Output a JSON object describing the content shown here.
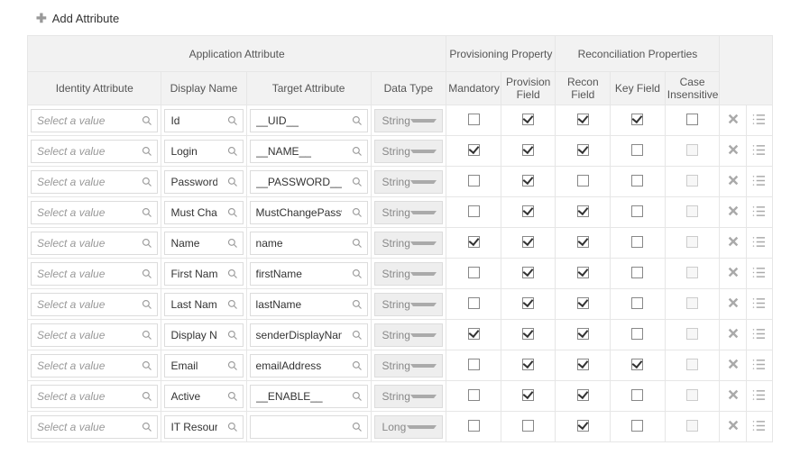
{
  "add_attribute_label": "Add Attribute",
  "headers": {
    "group_app_attr": "Application Attribute",
    "group_prov_prop": "Provisioning Property",
    "group_recon_prop": "Reconciliation Properties",
    "identity_attr": "Identity Attribute",
    "display_name": "Display Name",
    "target_attr": "Target Attribute",
    "data_type": "Data Type",
    "mandatory": "Mandatory",
    "provision_field": "Provision Field",
    "recon_field": "Recon Field",
    "key_field": "Key Field",
    "case_insensitive": "Case Insensitive"
  },
  "identity_placeholder": "Select a value",
  "rows": [
    {
      "display": "Id",
      "target": "__UID__",
      "dtype": "String",
      "mandatory": false,
      "prov": true,
      "recon": true,
      "key": true,
      "ci": false,
      "ci_disabled": false
    },
    {
      "display": "Login",
      "target": "__NAME__",
      "dtype": "String",
      "mandatory": true,
      "prov": true,
      "recon": true,
      "key": false,
      "ci": false,
      "ci_disabled": true
    },
    {
      "display": "Password",
      "target": "__PASSWORD__",
      "dtype": "String",
      "mandatory": false,
      "prov": true,
      "recon": false,
      "key": false,
      "ci": false,
      "ci_disabled": true
    },
    {
      "display": "Must Change Password",
      "display_trunc": "Must Change P",
      "target": "MustChangePassword",
      "dtype": "String",
      "mandatory": false,
      "prov": true,
      "recon": true,
      "key": false,
      "ci": false,
      "ci_disabled": true
    },
    {
      "display": "Name",
      "target": "name",
      "dtype": "String",
      "mandatory": true,
      "prov": true,
      "recon": true,
      "key": false,
      "ci": false,
      "ci_disabled": true
    },
    {
      "display": "First Name",
      "target": "firstName",
      "dtype": "String",
      "mandatory": false,
      "prov": true,
      "recon": true,
      "key": false,
      "ci": false,
      "ci_disabled": true
    },
    {
      "display": "Last Name",
      "target": "lastName",
      "dtype": "String",
      "mandatory": false,
      "prov": true,
      "recon": true,
      "key": false,
      "ci": false,
      "ci_disabled": true
    },
    {
      "display": "Display Name",
      "target": "senderDisplayName",
      "dtype": "String",
      "mandatory": true,
      "prov": true,
      "recon": true,
      "key": false,
      "ci": false,
      "ci_disabled": true
    },
    {
      "display": "Email",
      "target": "emailAddress",
      "dtype": "String",
      "mandatory": false,
      "prov": true,
      "recon": true,
      "key": true,
      "ci": false,
      "ci_disabled": true
    },
    {
      "display": "Active",
      "target": "__ENABLE__",
      "dtype": "String",
      "mandatory": false,
      "prov": true,
      "recon": true,
      "key": false,
      "ci": false,
      "ci_disabled": true
    },
    {
      "display": "IT Resource Name",
      "display_trunc": "IT Resource Na",
      "target": "",
      "dtype": "Long",
      "mandatory": false,
      "prov": false,
      "recon": true,
      "key": false,
      "ci": false,
      "ci_disabled": true
    }
  ],
  "icons": {
    "plus": "plus-icon",
    "search": "search-icon",
    "delete": "close-icon",
    "menu": "list-icon"
  }
}
